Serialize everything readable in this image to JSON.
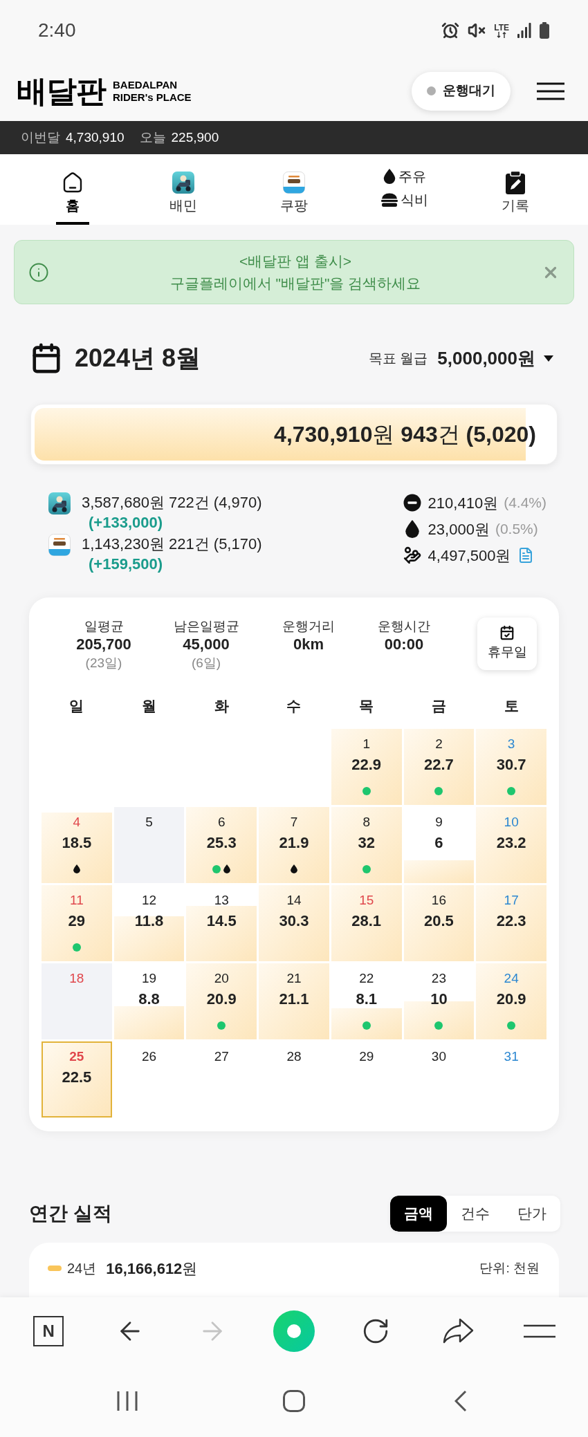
{
  "status_bar": {
    "time": "2:40",
    "network": "LTE"
  },
  "header": {
    "logo": "배달판",
    "tagline": [
      "BAEDALPAN",
      "RIDER's PLACE"
    ],
    "status_button": {
      "label": "운행대기",
      "active": false
    }
  },
  "totals_bar": [
    {
      "label": "이번달",
      "value": "4,730,910"
    },
    {
      "label": "오늘",
      "value": "225,900"
    }
  ],
  "tabs": [
    {
      "kind": "home",
      "label": "홈",
      "selected": true
    },
    {
      "kind": "baemin",
      "label": "배민",
      "selected": false
    },
    {
      "kind": "coupang",
      "label": "쿠팡",
      "selected": false
    },
    {
      "kind": "split",
      "lines": [
        {
          "kind": "fuel",
          "label": "주유"
        },
        {
          "kind": "meal",
          "label": "식비"
        }
      ],
      "selected": false
    },
    {
      "kind": "record",
      "label": "기록",
      "selected": false
    }
  ],
  "notice": {
    "title": "<배달판 앱 출시>",
    "message": "구글플레이에서 \"배달판\"을 검색하세요"
  },
  "month": {
    "title": "2024년 8월",
    "goal_label": "목표 월급",
    "goal_value": "5,000,000원"
  },
  "progress": {
    "text": "**4,730,910**원 **943**건 **(5,020)**",
    "level": 0.946
  },
  "platforms": [
    {
      "kind": "baemin",
      "summary": "3,587,680원 722건 (4,970)",
      "diff": "(+133,000)"
    },
    {
      "kind": "coupang",
      "summary": "1,143,230원 221건 (5,170)",
      "diff": "(+159,500)"
    }
  ],
  "costs": [
    {
      "kind": "minus",
      "amount": "210,410원",
      "share": "(4.4%)"
    },
    {
      "kind": "fuel",
      "amount": "23,000원",
      "share": "(0.5%)"
    },
    {
      "kind": "net",
      "amount": "4,497,500원"
    }
  ],
  "calendar": {
    "stats": [
      {
        "label": "일평균",
        "value": "205,700",
        "note": "(23일)"
      },
      {
        "label": "남은일평균",
        "value": "45,000",
        "note": "(6일)"
      },
      {
        "label": "운행거리",
        "value": "0km"
      },
      {
        "label": "운행시간",
        "value": "00:00"
      }
    ],
    "dayoff_button": "휴무일",
    "weekdays": [
      "일",
      "월",
      "화",
      "수",
      "목",
      "금",
      "토"
    ],
    "weeks": [
      [
        {
          "kind": "blank"
        },
        {
          "kind": "blank"
        },
        {
          "kind": "blank"
        },
        {
          "kind": "blank"
        },
        {
          "kind": "day",
          "date": "1",
          "value": "22.9",
          "level": 1,
          "color": "#222222",
          "off": false,
          "today": false,
          "dot": true,
          "fuel": false
        },
        {
          "kind": "day",
          "date": "2",
          "value": "22.7",
          "level": 1,
          "color": "#222222",
          "off": false,
          "today": false,
          "dot": true,
          "fuel": false
        },
        {
          "kind": "day",
          "date": "3",
          "value": "30.7",
          "level": 1,
          "color": "#2b87d1",
          "off": false,
          "today": false,
          "dot": true,
          "fuel": false
        }
      ],
      [
        {
          "kind": "day",
          "date": "4",
          "value": "18.5",
          "level": 0.93,
          "color": "#e0474c",
          "off": false,
          "today": false,
          "dot": false,
          "fuel": true
        },
        {
          "kind": "day",
          "date": "5",
          "color": "#222222",
          "off": true,
          "today": false,
          "dot": false,
          "fuel": false
        },
        {
          "kind": "day",
          "date": "6",
          "value": "25.3",
          "level": 1,
          "color": "#222222",
          "off": false,
          "today": false,
          "dot": true,
          "fuel": true
        },
        {
          "kind": "day",
          "date": "7",
          "value": "21.9",
          "level": 1,
          "color": "#222222",
          "off": false,
          "today": false,
          "dot": false,
          "fuel": true
        },
        {
          "kind": "day",
          "date": "8",
          "value": "32",
          "level": 1,
          "color": "#222222",
          "off": false,
          "today": false,
          "dot": true,
          "fuel": false
        },
        {
          "kind": "day",
          "date": "9",
          "value": "6",
          "level": 0.3,
          "color": "#222222",
          "off": false,
          "today": false,
          "dot": false,
          "fuel": false
        },
        {
          "kind": "day",
          "date": "10",
          "value": "23.2",
          "level": 1,
          "color": "#2b87d1",
          "off": false,
          "today": false,
          "dot": false,
          "fuel": false
        }
      ],
      [
        {
          "kind": "day",
          "date": "11",
          "value": "29",
          "level": 1,
          "color": "#e0474c",
          "off": false,
          "today": false,
          "dot": true,
          "fuel": false
        },
        {
          "kind": "day",
          "date": "12",
          "value": "11.8",
          "level": 0.59,
          "color": "#222222",
          "off": false,
          "today": false,
          "dot": false,
          "fuel": false
        },
        {
          "kind": "day",
          "date": "13",
          "value": "14.5",
          "level": 0.73,
          "color": "#222222",
          "off": false,
          "today": false,
          "dot": false,
          "fuel": false
        },
        {
          "kind": "day",
          "date": "14",
          "value": "30.3",
          "level": 1,
          "color": "#222222",
          "off": false,
          "today": false,
          "dot": false,
          "fuel": false
        },
        {
          "kind": "day",
          "date": "15",
          "value": "28.1",
          "level": 1,
          "color": "#e0474c",
          "off": false,
          "today": false,
          "dot": false,
          "fuel": false
        },
        {
          "kind": "day",
          "date": "16",
          "value": "20.5",
          "level": 1,
          "color": "#222222",
          "off": false,
          "today": false,
          "dot": false,
          "fuel": false
        },
        {
          "kind": "day",
          "date": "17",
          "value": "22.3",
          "level": 1,
          "color": "#2b87d1",
          "off": false,
          "today": false,
          "dot": false,
          "fuel": false
        }
      ],
      [
        {
          "kind": "day",
          "date": "18",
          "color": "#e0474c",
          "off": true,
          "today": false,
          "dot": false,
          "fuel": false
        },
        {
          "kind": "day",
          "date": "19",
          "value": "8.8",
          "level": 0.44,
          "color": "#222222",
          "off": false,
          "today": false,
          "dot": false,
          "fuel": false
        },
        {
          "kind": "day",
          "date": "20",
          "value": "20.9",
          "level": 1,
          "color": "#222222",
          "off": false,
          "today": false,
          "dot": true,
          "fuel": false
        },
        {
          "kind": "day",
          "date": "21",
          "value": "21.1",
          "level": 1,
          "color": "#222222",
          "off": false,
          "today": false,
          "dot": false,
          "fuel": false
        },
        {
          "kind": "day",
          "date": "22",
          "value": "8.1",
          "level": 0.41,
          "color": "#222222",
          "off": false,
          "today": false,
          "dot": true,
          "fuel": false
        },
        {
          "kind": "day",
          "date": "23",
          "value": "10",
          "level": 0.5,
          "color": "#222222",
          "off": false,
          "today": false,
          "dot": true,
          "fuel": false
        },
        {
          "kind": "day",
          "date": "24",
          "value": "20.9",
          "level": 1,
          "color": "#2b87d1",
          "off": false,
          "today": false,
          "dot": true,
          "fuel": false
        }
      ],
      [
        {
          "kind": "day",
          "date": "25",
          "value": "22.5",
          "level": 1,
          "color": "#e0474c",
          "off": false,
          "today": true,
          "dot": false,
          "fuel": false
        },
        {
          "kind": "day",
          "date": "26",
          "level": 0,
          "color": "#222222",
          "off": false,
          "today": false,
          "dot": false,
          "fuel": false
        },
        {
          "kind": "day",
          "date": "27",
          "level": 0,
          "color": "#222222",
          "off": false,
          "today": false,
          "dot": false,
          "fuel": false
        },
        {
          "kind": "day",
          "date": "28",
          "level": 0,
          "color": "#222222",
          "off": false,
          "today": false,
          "dot": false,
          "fuel": false
        },
        {
          "kind": "day",
          "date": "29",
          "level": 0,
          "color": "#222222",
          "off": false,
          "today": false,
          "dot": false,
          "fuel": false
        },
        {
          "kind": "day",
          "date": "30",
          "level": 0,
          "color": "#222222",
          "off": false,
          "today": false,
          "dot": false,
          "fuel": false
        },
        {
          "kind": "day",
          "date": "31",
          "level": 0,
          "color": "#2b87d1",
          "off": false,
          "today": false,
          "dot": false,
          "fuel": false
        }
      ]
    ]
  },
  "annual": {
    "title": "연간 실적",
    "tabs": [
      {
        "label": "금액",
        "selected": true
      },
      {
        "label": "건수",
        "selected": false
      },
      {
        "label": "단가",
        "selected": false
      }
    ],
    "legend": {
      "label": "24년",
      "value": "**16,166,612**원"
    },
    "unit": "단위: 천원"
  },
  "browser_toolbar": {
    "home_letter": "N",
    "forward": {
      "disabled": true
    }
  }
}
